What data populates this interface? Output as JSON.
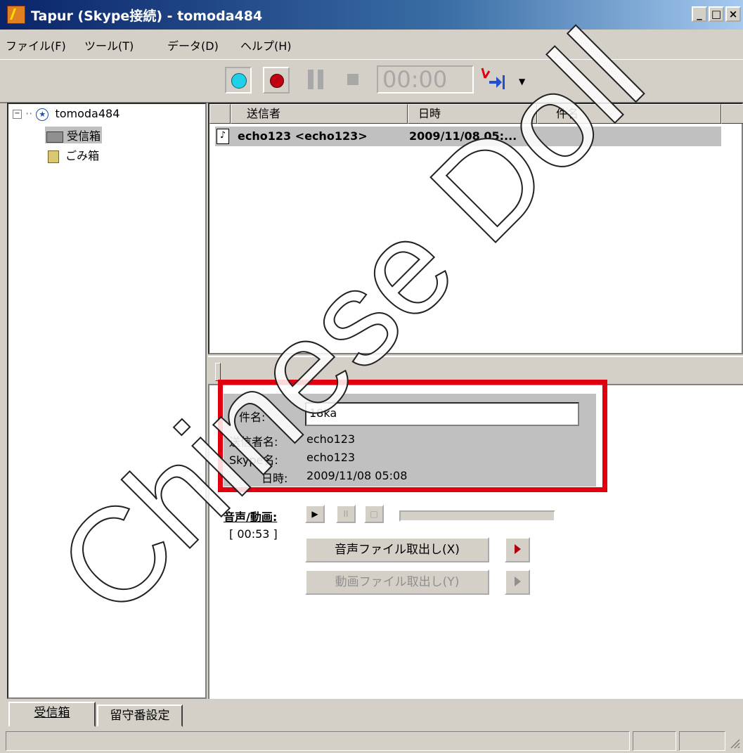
{
  "window": {
    "title": "Tapur (Skype接続) - tomoda484",
    "minimize": "_",
    "maximize": "□",
    "close": "×"
  },
  "menu": [
    "ファイル(F)",
    "ツール(T)",
    "データ(D)",
    "ヘルプ(H)"
  ],
  "toolbar": {
    "timer": "00:00",
    "icons": [
      "connect-icon",
      "record-icon",
      "pause-icon",
      "stop-icon",
      "voicemail-icon"
    ]
  },
  "tree": {
    "root": "tomoda484",
    "items": [
      "受信箱",
      "ごみ箱"
    ]
  },
  "list": {
    "columns": [
      "送信者",
      "日時",
      "件名"
    ],
    "rows": [
      {
        "sender": "echo123 <echo123>",
        "datetime": "2009/11/08 05:..."
      }
    ]
  },
  "detail": {
    "subject_label": "件名:",
    "subject_value": "18ka",
    "sender_label": "送信者名:",
    "sender_value": "echo123",
    "skype_label": "Skype名:",
    "skype_value": "echo123",
    "date_label": "日時:",
    "date_value": "2009/11/08 05:08",
    "media_label": "音声/動画:",
    "duration": "[ 00:53 ]",
    "extract_audio": "音声ファイル取出し(X)",
    "extract_video": "動画ファイル取出し(Y)"
  },
  "tabs": [
    "受信箱",
    "留守番設定"
  ],
  "watermark": "Chinese Doll",
  "colors": {
    "highlight_box": "#e00010",
    "record_red": "#c00010",
    "connect_cyan": "#20d0e8"
  }
}
